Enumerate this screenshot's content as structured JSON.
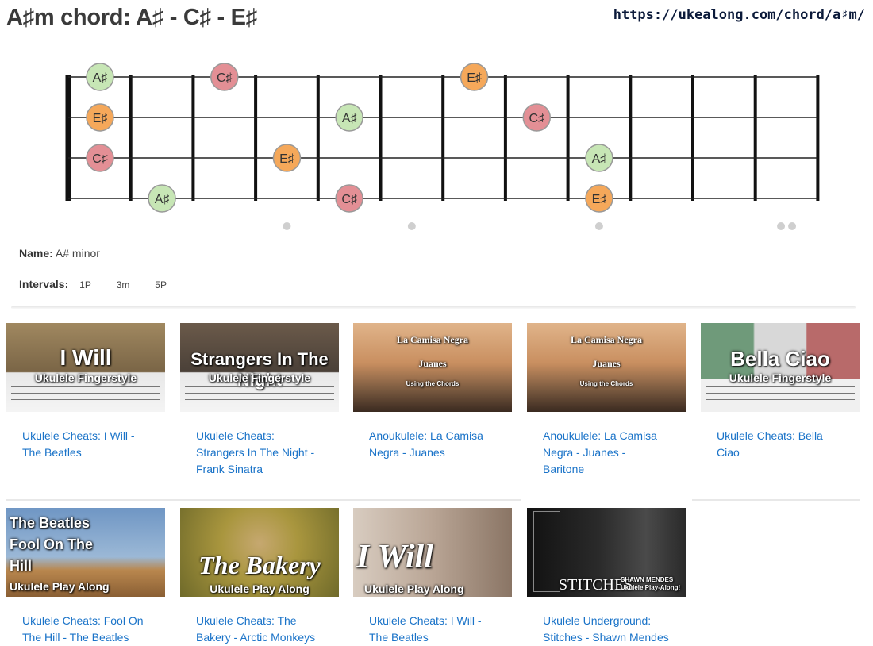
{
  "title": "A♯m chord: A♯ - C♯ - E♯",
  "url": "https://ukealong.com/chord/a♯m/",
  "fretboard": {
    "strings": 4,
    "frets": 12,
    "notes": [
      {
        "string": 1,
        "fret": 0,
        "label": "A♯",
        "color": "#c7e6b5"
      },
      {
        "string": 1,
        "fret": 3,
        "label": "C♯",
        "color": "#e38f95"
      },
      {
        "string": 1,
        "fret": 7,
        "label": "E♯",
        "color": "#f5a85a"
      },
      {
        "string": 2,
        "fret": 0,
        "label": "E♯",
        "color": "#f5a85a"
      },
      {
        "string": 2,
        "fret": 5,
        "label": "A♯",
        "color": "#c7e6b5"
      },
      {
        "string": 2,
        "fret": 8,
        "label": "C♯",
        "color": "#e38f95"
      },
      {
        "string": 3,
        "fret": 0,
        "label": "C♯",
        "color": "#e38f95"
      },
      {
        "string": 3,
        "fret": 4,
        "label": "E♯",
        "color": "#f5a85a"
      },
      {
        "string": 3,
        "fret": 9,
        "label": "A♯",
        "color": "#c7e6b5"
      },
      {
        "string": 4,
        "fret": 2,
        "label": "A♯",
        "color": "#c7e6b5"
      },
      {
        "string": 4,
        "fret": 5,
        "label": "C♯",
        "color": "#e38f95"
      },
      {
        "string": 4,
        "fret": 9,
        "label": "E♯",
        "color": "#f5a85a"
      }
    ],
    "markers": [
      4,
      6,
      9,
      12
    ]
  },
  "name_label": "Name:",
  "name_value": "A# minor",
  "intervals_label": "Intervals:",
  "intervals": [
    "1P",
    "3m",
    "5P"
  ],
  "videos": [
    {
      "link": "Ukulele Cheats: I Will - The Beatles",
      "thumb_title": "I Will",
      "thumb_sub": "Ukulele Fingerstyle",
      "bg": "#8a7a5a"
    },
    {
      "link": "Ukulele Cheats: Strangers In The Night - Frank Sinatra",
      "thumb_title": "Strangers In The Night",
      "thumb_sub": "Ukulele Fingerstyle",
      "bg": "#5a5048"
    },
    {
      "link": "Anoukulele: La Camisa Negra - Juanes",
      "thumb_title": "La Camisa Negra",
      "thumb_sub": "Juanes",
      "thumb_foot": "Using the Chords",
      "bg": "#c99466"
    },
    {
      "link": "Anoukulele: La Camisa Negra - Juanes - Baritone",
      "thumb_title": "La Camisa Negra",
      "thumb_sub": "Juanes",
      "thumb_foot": "Using the Chords",
      "bg": "#c99466"
    },
    {
      "link": "Ukulele Cheats: Bella Ciao",
      "thumb_title": "Bella Ciao",
      "thumb_sub": "Ukulele Fingerstyle",
      "bg": "#6f9a7a"
    },
    {
      "link": "Ukulele Cheats: Fool On The Hill - The Beatles",
      "thumb_title": "The Beatles Fool On The Hill",
      "thumb_sub": "Ukulele Play Along",
      "bg": "#7a9cc0"
    },
    {
      "link": "Ukulele Cheats: The Bakery - Arctic Monkeys",
      "thumb_title": "The Bakery",
      "thumb_sub": "Ukulele Play Along",
      "bg": "#b7a547"
    },
    {
      "link": "Ukulele Cheats: I Will - The Beatles",
      "thumb_title": "I Will",
      "thumb_sub": "Ukulele Play Along",
      "bg": "#b9a595"
    },
    {
      "link": "Ukulele Underground: Stitches - Shawn Mendes",
      "thumb_title": "STITCHES",
      "thumb_sub": "SHAWN MENDES Ukulele Play-Along!",
      "bg": "#2a2a2a"
    }
  ]
}
